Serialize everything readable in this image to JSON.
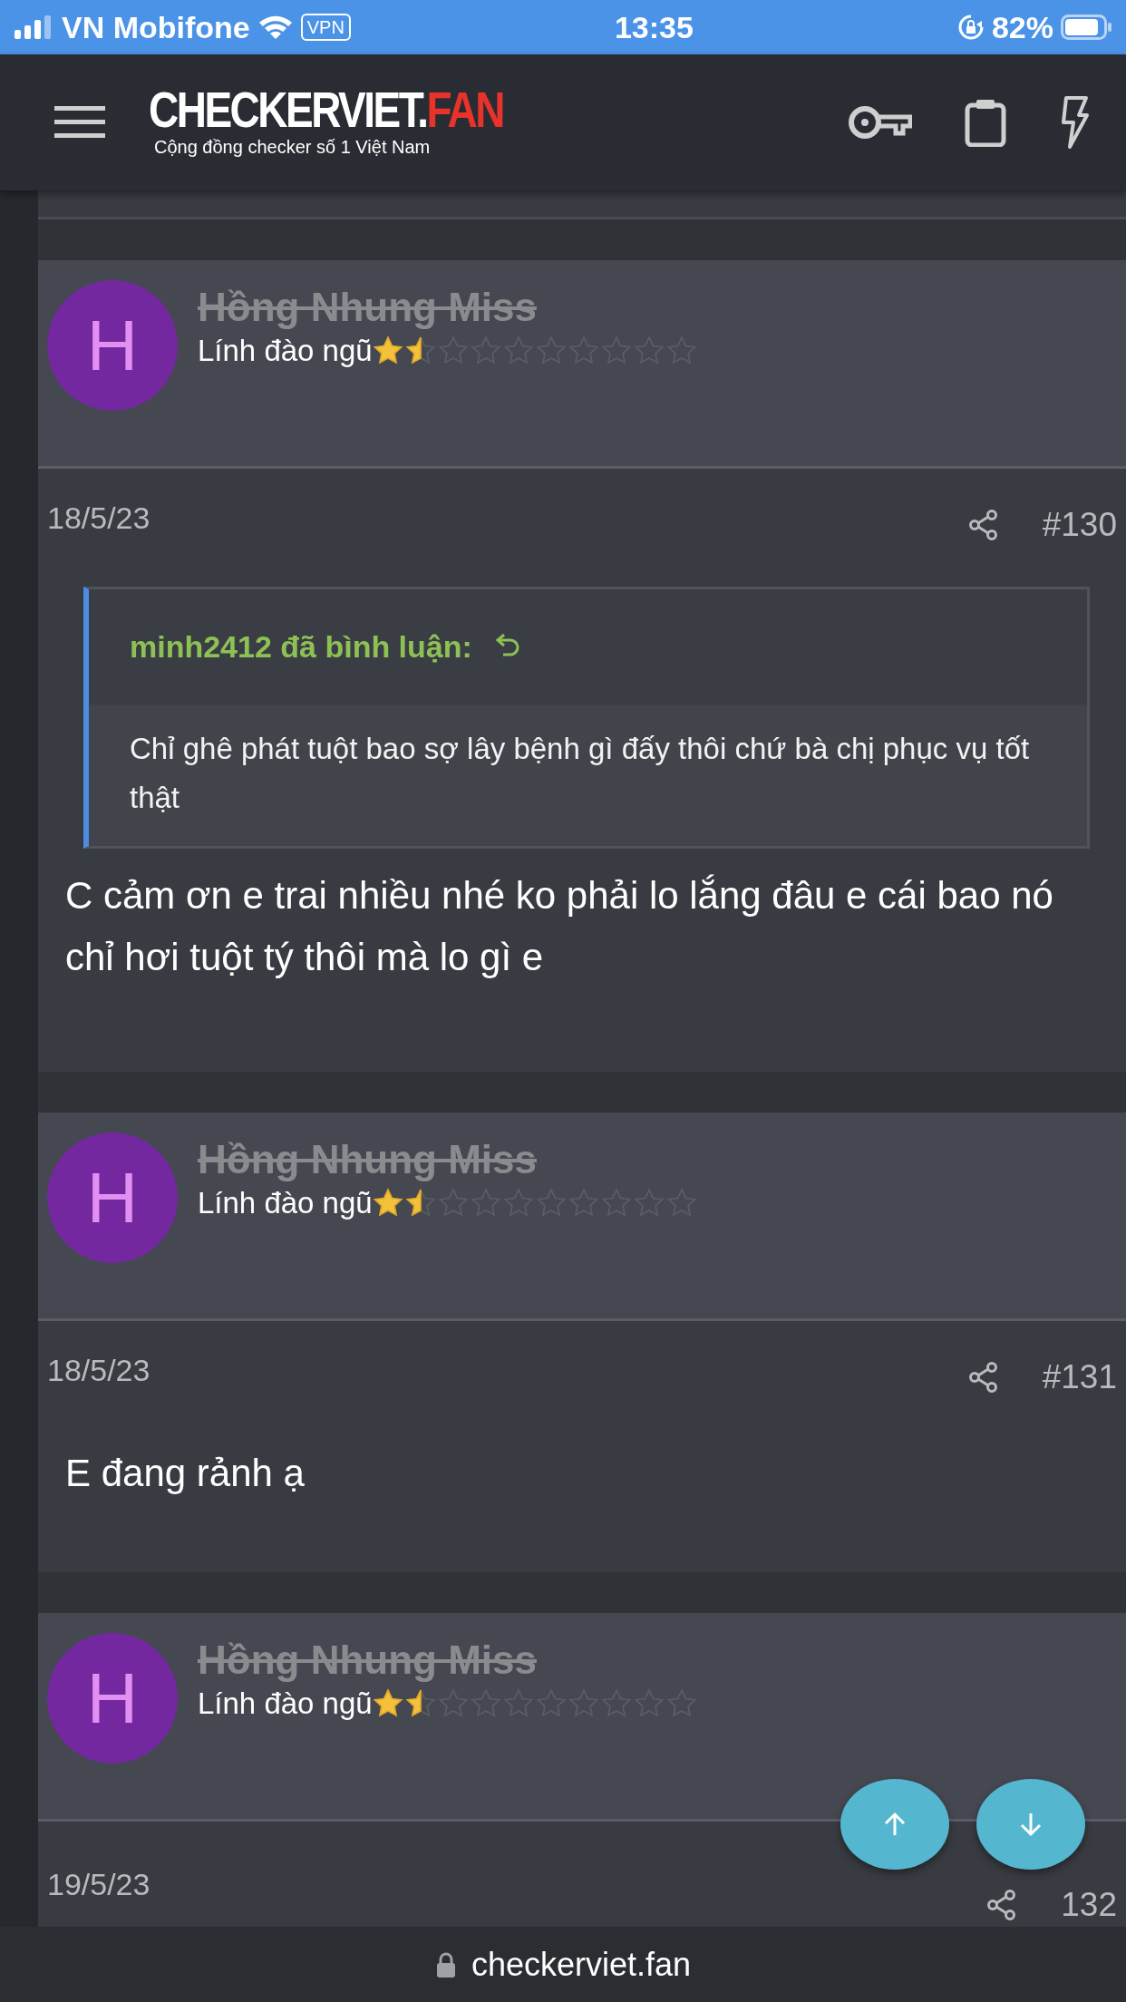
{
  "status_bar": {
    "carrier": "VN Mobifone",
    "vpn": "VPN",
    "time": "13:35",
    "battery": "82%"
  },
  "header": {
    "logo": {
      "text": "CHECKERVIET.",
      "accent": "FAN",
      "tagline": "Cộng đồng checker số 1 Việt Nam"
    }
  },
  "posts": [
    {
      "author": "Hồng Nhung Miss",
      "avatar": "H",
      "rank": "Lính đào ngũ",
      "stars": 1.5,
      "date": "18/5/23",
      "number": "#130",
      "quote": {
        "author": "minh2412 đã bình luận:",
        "text": "Chỉ ghê phát tuột bao sợ lây bệnh gì đấy thôi chứ bà chị phục vụ tốt thật"
      },
      "text": "C cảm ơn e trai nhiều nhé ko phải lo lắng đâu e cái bao nó chỉ hơi tuột tý thôi mà lo gì e"
    },
    {
      "author": "Hồng Nhung Miss",
      "avatar": "H",
      "rank": "Lính đào ngũ",
      "stars": 1.5,
      "date": "18/5/23",
      "number": "#131",
      "text": "E đang rảnh ạ"
    },
    {
      "author": "Hồng Nhung Miss",
      "avatar": "H",
      "rank": "Lính đào ngũ",
      "stars": 1.5,
      "date": "19/5/23",
      "number": "132"
    }
  ],
  "url_bar": {
    "address": "checkerviet.fan"
  }
}
